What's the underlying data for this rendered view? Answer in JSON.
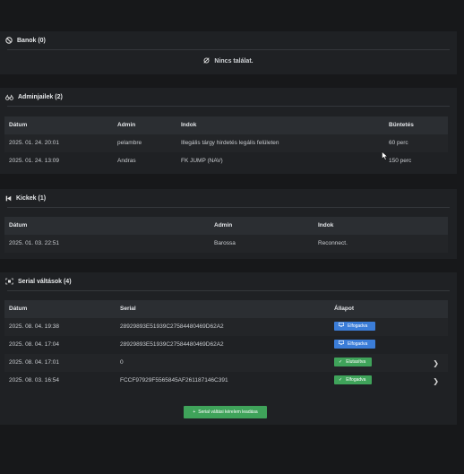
{
  "bans": {
    "title": "Banok (0)",
    "empty_text": "Nincs találat."
  },
  "admin_jails": {
    "title": "Adminjailek (2)",
    "headers": [
      "Dátum",
      "Admin",
      "Indok",
      "Büntetés"
    ],
    "rows": [
      {
        "date": "2025. 01. 24. 20:01",
        "admin": "pelambre",
        "reason": "Illegális tárgy hirdetés legális felületen",
        "penalty": "60 perc"
      },
      {
        "date": "2025. 01. 24. 13:09",
        "admin": "Andras",
        "reason": "FK JUMP (NAV)",
        "penalty": "150 perc"
      }
    ]
  },
  "kicks": {
    "title": "Kickek (1)",
    "headers": [
      "Dátum",
      "Admin",
      "Indok"
    ],
    "rows": [
      {
        "date": "2025. 01. 03. 22:51",
        "admin": "Barossa",
        "reason": "Reconnect."
      }
    ]
  },
  "serials": {
    "title": "Serial váltások (4)",
    "headers": [
      "Dátum",
      "Serial",
      "Állapot"
    ],
    "rows": [
      {
        "date": "2025. 08. 04. 19:38",
        "serial": "28929893E51939C27584480469D62A2",
        "status": "Elfogadva",
        "status_color": "blue",
        "status_icon": "monitor-icon",
        "has_arrow": false
      },
      {
        "date": "2025. 08. 04. 17:04",
        "serial": "28929893E51939C27584480469D62A2",
        "status": "Elfogadva",
        "status_color": "blue",
        "status_icon": "monitor-icon",
        "has_arrow": false
      },
      {
        "date": "2025. 08. 04. 17:01",
        "serial": "0",
        "status": "Elutasítva",
        "status_color": "green",
        "status_icon": "check-icon",
        "has_arrow": true
      },
      {
        "date": "2025. 08. 03. 16:54",
        "serial": "FCCF97929F5565845AF261187146C391",
        "status": "Elfogadva",
        "status_color": "green",
        "status_icon": "check-icon",
        "has_arrow": true
      }
    ],
    "request_button": "Serial váltási kérelem leadása"
  },
  "colors": {
    "background": "#17181a",
    "panel": "#1f2124",
    "header_row": "#2b2e32",
    "badge_blue": "#3b7dd8",
    "badge_green": "#3fa35a"
  }
}
